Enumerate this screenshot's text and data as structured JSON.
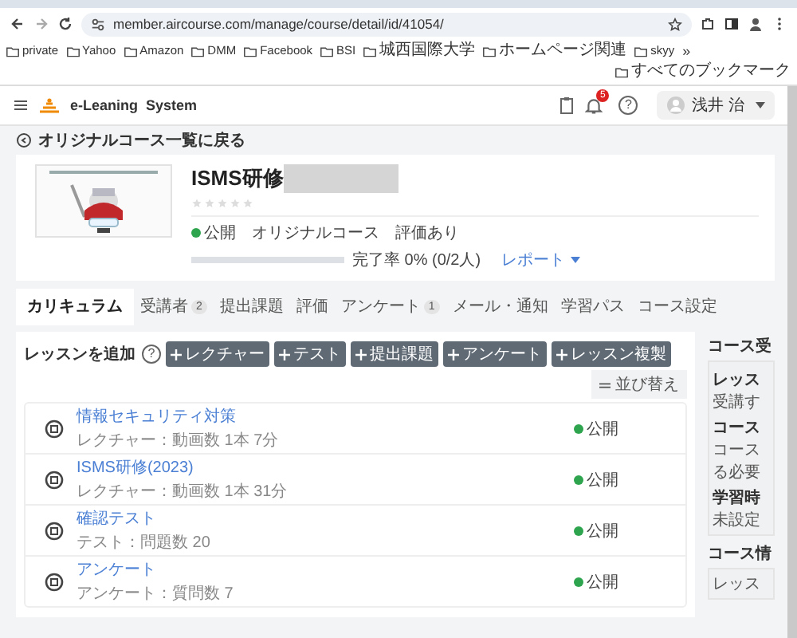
{
  "browser": {
    "url": "member.aircourse.com/manage/course/detail/id/41054/",
    "bookmarks": [
      "private",
      "Yahoo",
      "Amazon",
      "DMM",
      "Facebook",
      "BSI",
      "城西国際大学",
      "ホームページ関連",
      "skyy"
    ],
    "more": "»",
    "all_bookmarks": "すべてのブックマーク"
  },
  "header": {
    "app_name": "e-Leaning  System",
    "notification_count": "5",
    "help": "?",
    "user": "浅井 治"
  },
  "back_link": "オリジナルコース一覧に戻る",
  "course": {
    "title": "ISMS研修",
    "stars": 0,
    "status": "公開",
    "type": "オリジナルコース",
    "rating": "評価あり",
    "progress": {
      "level": 0,
      "reading": "完了率 0% (0/2人)"
    },
    "report": "レポート"
  },
  "tabs": [
    {
      "label": "カリキュラム",
      "selected": true
    },
    {
      "label": "受講者",
      "badge": "2",
      "selected": false
    },
    {
      "label": "提出課題",
      "selected": false
    },
    {
      "label": "評価",
      "selected": false
    },
    {
      "label": "アンケート",
      "badge": "1",
      "selected": false
    },
    {
      "label": "メール・通知",
      "selected": false
    },
    {
      "label": "学習パス",
      "selected": false
    },
    {
      "label": "コース設定",
      "selected": false
    }
  ],
  "lessons_panel": {
    "title": "レッスンを追加",
    "help": "?",
    "add_buttons": [
      "レクチャー",
      "テスト",
      "提出課題",
      "アンケート",
      "レッスン複製"
    ],
    "sort_button": "並び替え",
    "lessons": [
      {
        "title": "情報セキュリティ対策",
        "detail": "レクチャー：動画数 1本 7分",
        "status": "公開"
      },
      {
        "title": "ISMS研修(2023)",
        "detail": "レクチャー：動画数 1本 31分",
        "status": "公開"
      },
      {
        "title": "確認テスト",
        "detail": "テスト：問題数 20",
        "status": "公開"
      },
      {
        "title": "アンケート",
        "detail": "アンケート：質問数 7",
        "status": "公開"
      }
    ]
  },
  "sidebar": [
    {
      "heading": "コース受",
      "items": [
        {
          "kind": "label",
          "text": "レッス"
        },
        {
          "kind": "text",
          "text": "受講す"
        },
        {
          "kind": "label",
          "text": "コース"
        },
        {
          "kind": "text",
          "text": "コース"
        },
        {
          "kind": "text",
          "text": "る必要"
        },
        {
          "kind": "label",
          "text": "学習時"
        },
        {
          "kind": "text",
          "text": "未設定"
        }
      ]
    },
    {
      "heading": "コース情",
      "items": [
        {
          "kind": "text",
          "text": "レッス"
        }
      ]
    }
  ]
}
